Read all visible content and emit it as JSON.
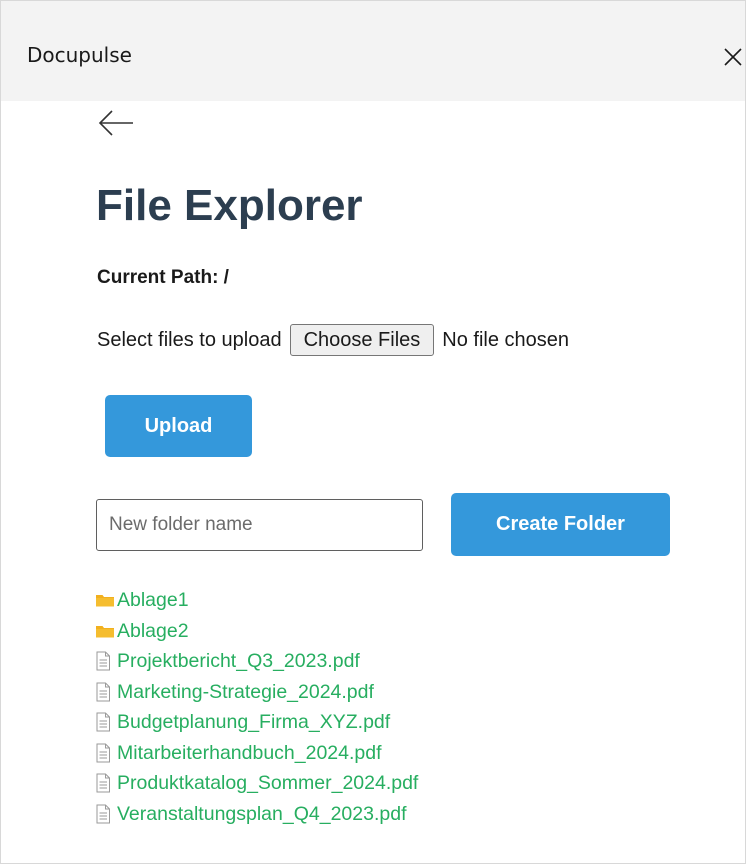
{
  "window": {
    "title": "Docupulse",
    "close_glyph": "×"
  },
  "page": {
    "title": "File Explorer",
    "current_path": "Current Path: /"
  },
  "upload": {
    "label": "Select files to upload",
    "choose_files_label": "Choose Files",
    "no_file_text": "No file chosen",
    "upload_button_label": "Upload"
  },
  "new_folder": {
    "placeholder": "New folder name",
    "value": "",
    "create_button_label": "Create Folder"
  },
  "items": [
    {
      "type": "folder",
      "icon": "folder-icon",
      "name": "Ablage1"
    },
    {
      "type": "folder",
      "icon": "folder-icon",
      "name": "Ablage2"
    },
    {
      "type": "file",
      "icon": "file-icon",
      "name": "Projektbericht_Q3_2023.pdf"
    },
    {
      "type": "file",
      "icon": "file-icon",
      "name": "Marketing-Strategie_2024.pdf"
    },
    {
      "type": "file",
      "icon": "file-icon",
      "name": "Budgetplanung_Firma_XYZ.pdf"
    },
    {
      "type": "file",
      "icon": "file-icon",
      "name": "Mitarbeiterhandbuch_2024.pdf"
    },
    {
      "type": "file",
      "icon": "file-icon",
      "name": "Produktkatalog_Sommer_2024.pdf"
    },
    {
      "type": "file",
      "icon": "file-icon",
      "name": "Veranstaltungsplan_Q4_2023.pdf"
    }
  ],
  "colors": {
    "accent": "#3498db",
    "link": "#27ae60",
    "heading": "#2c3e50",
    "folder": "#f2b01e",
    "titlebar": "#f3f3f3"
  }
}
